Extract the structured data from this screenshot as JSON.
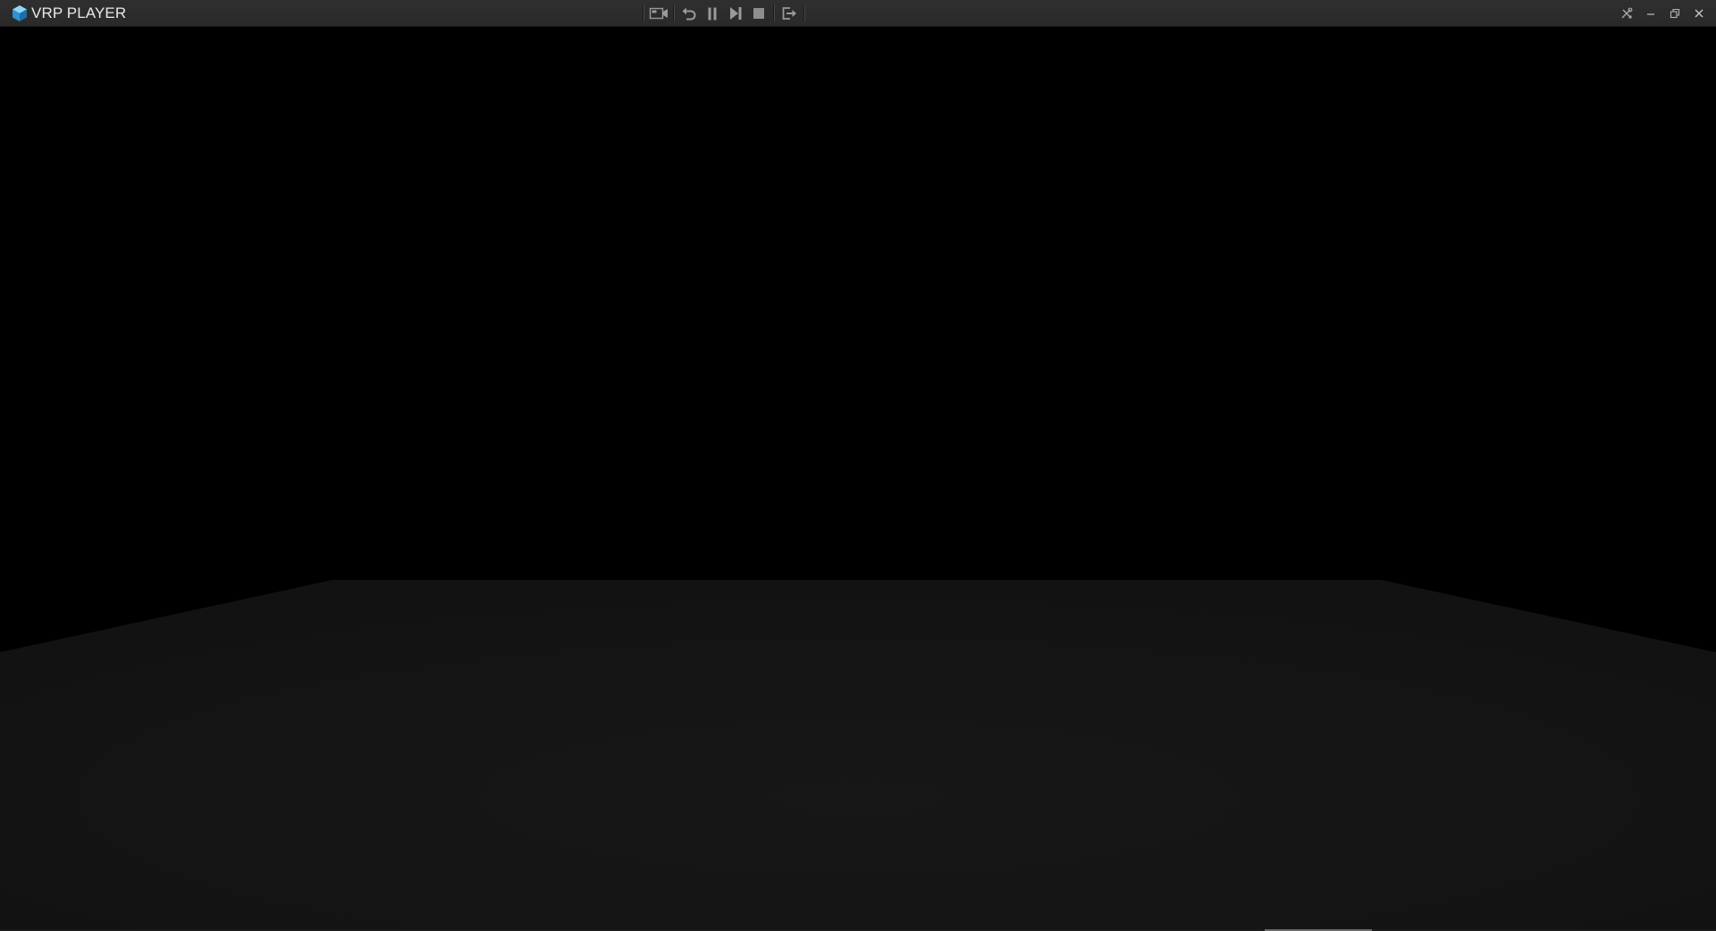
{
  "app": {
    "title": "VRP PLAYER",
    "logo_icon": "cube-logo-icon",
    "accent": "#3aa6e0"
  },
  "toolbar": {
    "buttons": [
      {
        "name": "record-camera-button",
        "icon": "video-camera-icon"
      },
      {
        "name": "replay-button",
        "icon": "undo-arrow-icon"
      },
      {
        "name": "pause-button",
        "icon": "pause-icon"
      },
      {
        "name": "step-forward-button",
        "icon": "skip-forward-icon"
      },
      {
        "name": "stop-button",
        "icon": "stop-square-icon"
      },
      {
        "name": "exit-button",
        "icon": "exit-icon"
      }
    ]
  },
  "window_controls": [
    {
      "name": "settings-button",
      "icon": "tools-icon"
    },
    {
      "name": "minimize-button",
      "icon": "minimize-icon"
    },
    {
      "name": "restore-button",
      "icon": "restore-icon"
    },
    {
      "name": "close-button",
      "icon": "close-icon"
    }
  ],
  "scene": {
    "background": "#000000",
    "floor_color": "#151515"
  }
}
